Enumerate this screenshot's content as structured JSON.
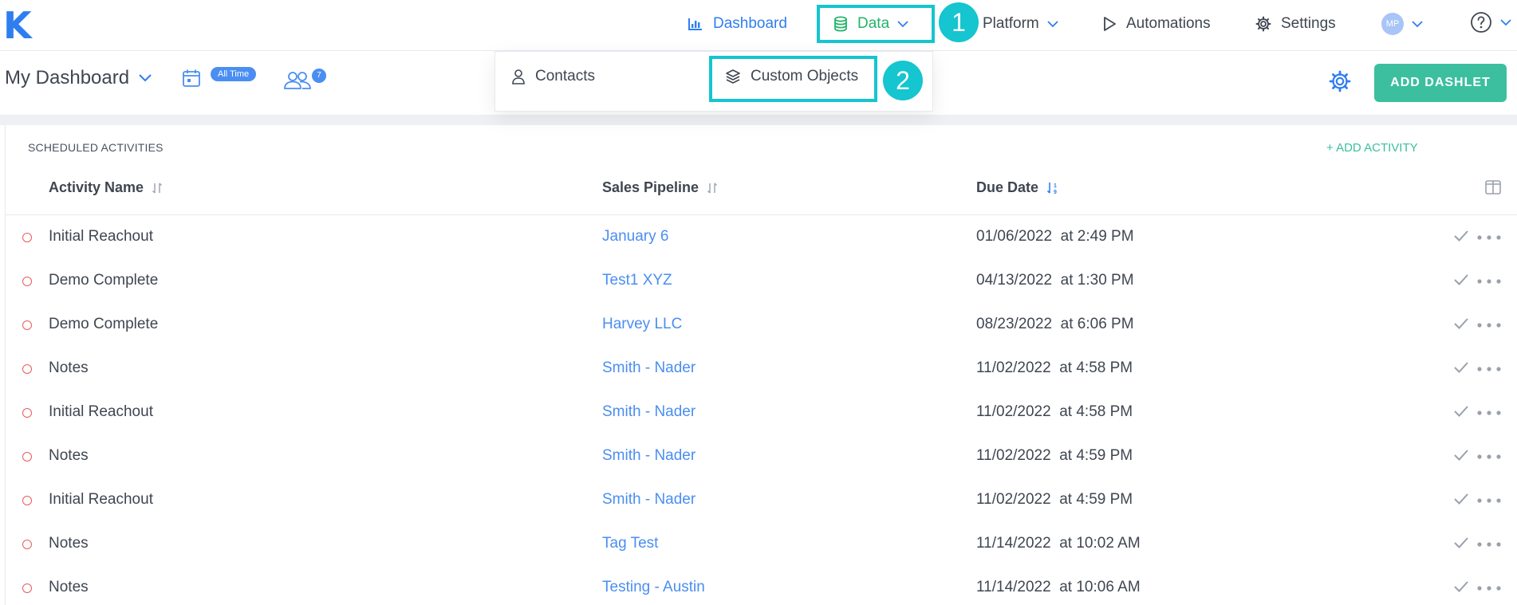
{
  "app": {
    "logo": "K"
  },
  "topnav": {
    "items": [
      {
        "label": "Dashboard",
        "icon": "bar-chart-icon",
        "active": true
      },
      {
        "label": "Data",
        "icon": "database-icon",
        "open": true
      },
      {
        "label": "Platform"
      },
      {
        "label": "Automations",
        "icon": "play-icon"
      },
      {
        "label": "Settings",
        "icon": "gear-icon"
      }
    ],
    "user_initials": "MP"
  },
  "steps": {
    "one": "1",
    "two": "2"
  },
  "data_menu": {
    "items": [
      {
        "label": "Contacts",
        "icon": "person-icon"
      },
      {
        "label": "Custom Objects",
        "icon": "layers-icon",
        "highlighted": true
      }
    ]
  },
  "dashboard": {
    "title": "My Dashboard",
    "date_filter_badge": "All Time",
    "users_count": "7",
    "add_dashlet_label": "ADD DASHLET"
  },
  "activities": {
    "title": "SCHEDULED ACTIVITIES",
    "add_label": "+ ADD ACTIVITY",
    "columns": [
      "Activity Name",
      "Sales Pipeline",
      "Due Date"
    ],
    "rows": [
      {
        "name": "Initial Reachout",
        "pipeline": "January 6",
        "due": "01/06/2022  at 2:49 PM"
      },
      {
        "name": "Demo Complete",
        "pipeline": "Test1 XYZ",
        "due": "04/13/2022  at 1:30 PM"
      },
      {
        "name": "Demo Complete",
        "pipeline": "Harvey LLC",
        "due": "08/23/2022  at 6:06 PM"
      },
      {
        "name": "Notes",
        "pipeline": "Smith - Nader",
        "due": "11/02/2022  at 4:58 PM"
      },
      {
        "name": "Initial Reachout",
        "pipeline": "Smith - Nader",
        "due": "11/02/2022  at 4:58 PM"
      },
      {
        "name": "Notes",
        "pipeline": "Smith - Nader",
        "due": "11/02/2022  at 4:59 PM"
      },
      {
        "name": "Initial Reachout",
        "pipeline": "Smith - Nader",
        "due": "11/02/2022  at 4:59 PM"
      },
      {
        "name": "Notes",
        "pipeline": "Tag Test",
        "due": "11/14/2022  at 10:02 AM"
      },
      {
        "name": "Notes",
        "pipeline": "Testing - Austin",
        "due": "11/14/2022  at 10:06 AM"
      }
    ]
  },
  "colors": {
    "brand": "#2f7ef0",
    "data_green": "#24b36b",
    "highlight": "#15c5cf",
    "accent_teal": "#3bbf9f",
    "link_blue": "#4a8ef2",
    "status_red": "#e85c5c"
  }
}
